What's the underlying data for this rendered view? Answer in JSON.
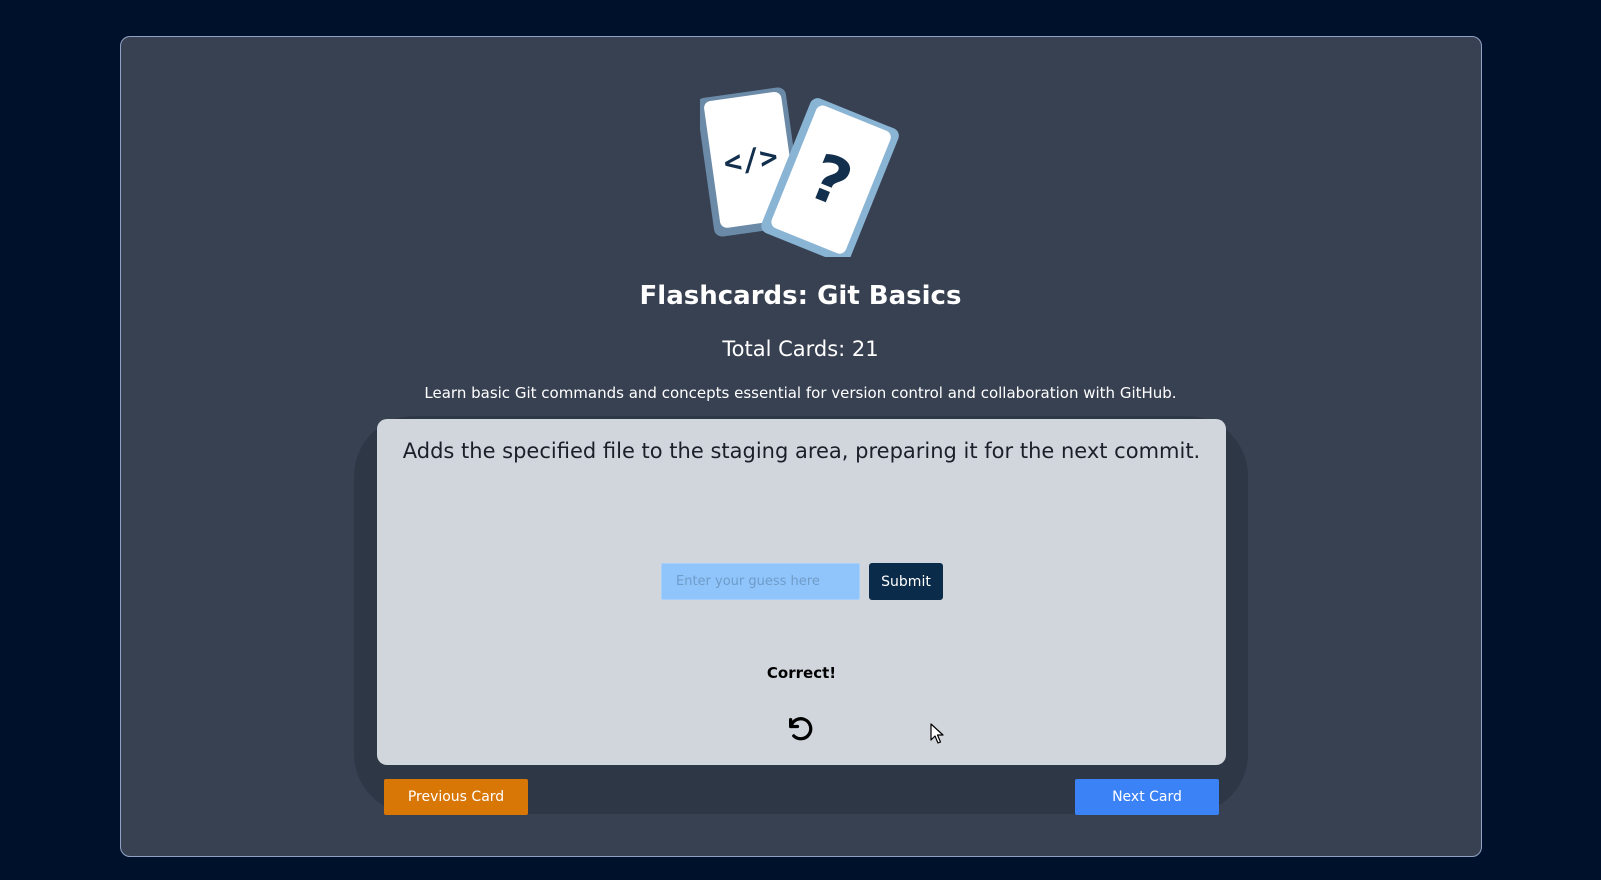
{
  "deck": {
    "title": "Flashcards: Git Basics",
    "total_cards": "Total Cards: 21",
    "description": "Learn basic Git commands and concepts essential for version control and collaboration with GitHub."
  },
  "logo": {
    "icon": "flashcards-logo-icon",
    "code_glyph": "</>",
    "question_glyph": "?"
  },
  "card": {
    "question": "Adds the specified file to the staging area, preparing it for the next commit.",
    "guess_value": "",
    "guess_placeholder": "Enter your guess here",
    "submit_label": "Submit",
    "result": "Correct!",
    "flip_icon": "rotate-ccw-icon"
  },
  "nav": {
    "previous_label": "Previous Card",
    "next_label": "Next Card"
  },
  "colors": {
    "page_bg": "#00112b",
    "panel_bg": "#384152",
    "card_bg": "#d1d5dc",
    "input_bg": "#90c5fc",
    "submit_bg": "#0b2b4a",
    "previous_bg": "#d97706",
    "next_bg": "#3b82f6"
  }
}
